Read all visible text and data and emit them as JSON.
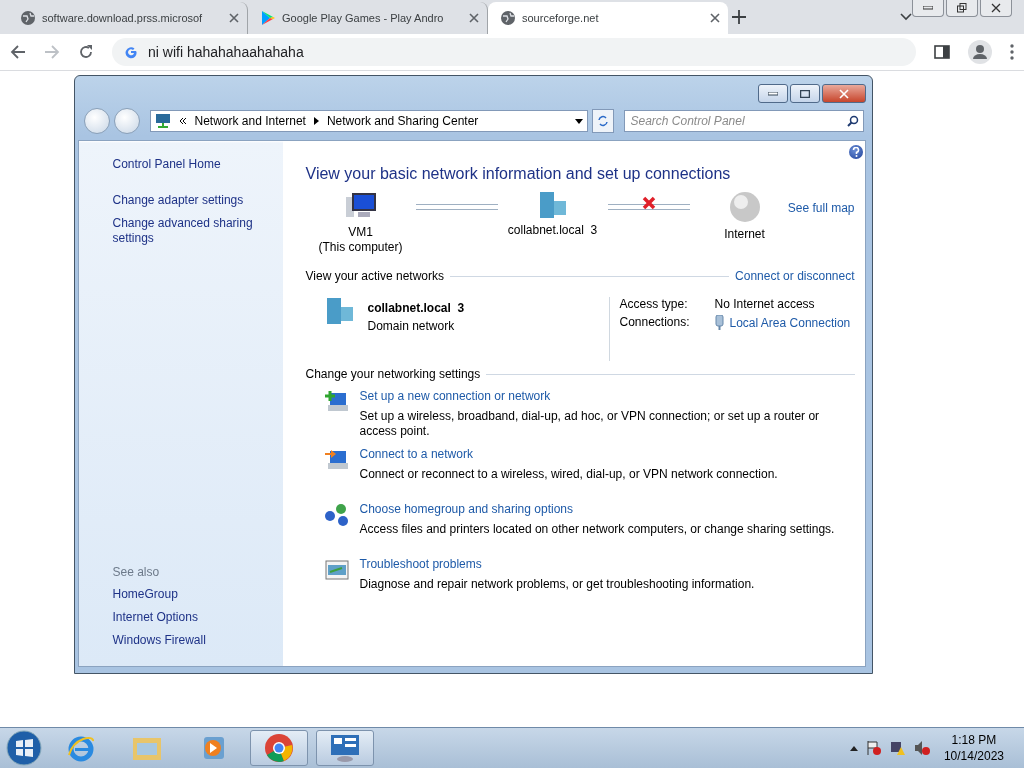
{
  "browser": {
    "tabs": [
      {
        "title": "software.download.prss.microsof",
        "kind": "globe",
        "selected": false
      },
      {
        "title": "Google Play Games - Play Andro",
        "kind": "play",
        "selected": false
      },
      {
        "title": "sourceforge.net",
        "kind": "globe",
        "selected": true
      }
    ],
    "address": {
      "value": "ni wifi hahahahaahahaha"
    }
  },
  "window": {
    "breadcrumbs": [
      "Network and Internet",
      "Network and Sharing Center"
    ],
    "search": {
      "placeholder": "Search Control Panel"
    }
  },
  "sidebar": {
    "home": "Control Panel Home",
    "links": [
      "Change adapter settings",
      "Change advanced sharing settings"
    ],
    "see_also_label": "See also",
    "see_also": [
      "HomeGroup",
      "Internet Options",
      "Windows Firewall"
    ]
  },
  "main": {
    "title": "View your basic network information and set up connections",
    "see_full_map": "See full map",
    "map": [
      {
        "kind": "computer",
        "label": "VM1",
        "sublabel": "(This computer)",
        "connected": true
      },
      {
        "kind": "domain",
        "label": "collabnet.local  3",
        "connected": false
      },
      {
        "kind": "internet",
        "label": "Internet"
      }
    ],
    "active": {
      "heading": "View your active networks",
      "action": "Connect or disconnect",
      "name": "collabnet.local  3",
      "type": "Domain network",
      "access_label": "Access type:",
      "access_value": "No Internet access",
      "connections_label": "Connections:",
      "connections_value": "Local Area Connection"
    },
    "settings": {
      "heading": "Change your networking settings",
      "tasks": [
        {
          "kind": "new",
          "title": "Set up a new connection or network",
          "description": "Set up a wireless, broadband, dial-up, ad hoc, or VPN connection; or set up a router or access point."
        },
        {
          "kind": "connect",
          "title": "Connect to a network",
          "description": "Connect or reconnect to a wireless, wired, dial-up, or VPN network connection."
        },
        {
          "kind": "homegroup",
          "title": "Choose homegroup and sharing options",
          "description": "Access files and printers located on other network computers, or change sharing settings."
        },
        {
          "kind": "troubleshoot",
          "title": "Troubleshoot problems",
          "description": "Diagnose and repair network problems, or get troubleshooting information."
        }
      ]
    }
  },
  "taskbar": {
    "apps": [
      {
        "kind": "ie",
        "selected": false
      },
      {
        "kind": "explorer",
        "selected": false
      },
      {
        "kind": "media",
        "selected": false
      },
      {
        "kind": "chrome",
        "selected": true
      },
      {
        "kind": "control",
        "selected": true
      }
    ],
    "time": "1:18 PM",
    "date": "10/14/2023"
  }
}
